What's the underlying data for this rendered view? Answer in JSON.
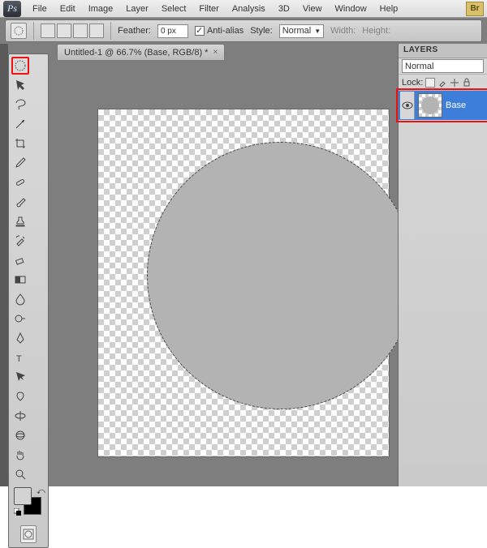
{
  "app": {
    "logo": "Ps",
    "bridge": "Br"
  },
  "menu": [
    "File",
    "Edit",
    "Image",
    "Layer",
    "Select",
    "Filter",
    "Analysis",
    "3D",
    "View",
    "Window",
    "Help"
  ],
  "options": {
    "feather_label": "Feather:",
    "feather_value": "0 px",
    "antialias": "Anti-alias",
    "style_label": "Style:",
    "style_value": "Normal",
    "width_label": "Width:",
    "height_label": "Height:"
  },
  "tab": {
    "title": "Untitled-1 @ 66.7% (Base, RGB/8) *",
    "close": "×"
  },
  "tools": [
    "elliptical-marquee",
    "move",
    "lasso",
    "magic-wand",
    "crop",
    "eyedropper",
    "healing",
    "brush",
    "stamp",
    "history-brush",
    "eraser",
    "gradient",
    "blur",
    "dodge",
    "pen",
    "type",
    "path-select",
    "shape",
    "3d-rotate",
    "3d-orbit",
    "hand",
    "zoom"
  ],
  "swatch": {
    "fg": "#d3d3d3",
    "bg": "#000000"
  },
  "panels": {
    "layers_tab": "LAYERS",
    "blend_mode": "Normal",
    "lock_label": "Lock:",
    "layer_name": "Base"
  }
}
